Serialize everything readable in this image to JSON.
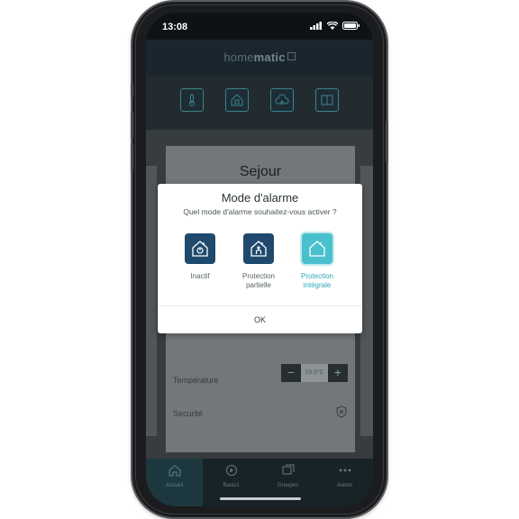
{
  "status": {
    "time": "13:08"
  },
  "header": {
    "logo_light": "home",
    "logo_bold": "matic"
  },
  "background": {
    "room_title": "Sejour",
    "temperature_label": "Température",
    "temperature_value": "19.0°C",
    "security_label": "Securité"
  },
  "tabs": [
    {
      "label": "Accueil",
      "icon": "home-icon"
    },
    {
      "label": "Basics",
      "icon": "play-icon"
    },
    {
      "label": "Groupes",
      "icon": "groups-icon"
    },
    {
      "label": "Autres",
      "icon": "more-icon"
    }
  ],
  "dialog": {
    "title": "Mode d'alarme",
    "subtitle": "Quel mode d'alarme souhaitez-vous activer ?",
    "options": [
      {
        "label": "Inactif",
        "icon": "house-power-icon",
        "selected": false
      },
      {
        "label": "Protection partielle",
        "icon": "house-person-icon",
        "selected": false
      },
      {
        "label": "Protection intégrale",
        "icon": "house-outline-icon",
        "selected": true
      }
    ],
    "ok_label": "OK"
  },
  "colors": {
    "accent": "#49c1cc",
    "option_dark": "#1f4a6d",
    "header_bg": "#1d2a31"
  }
}
